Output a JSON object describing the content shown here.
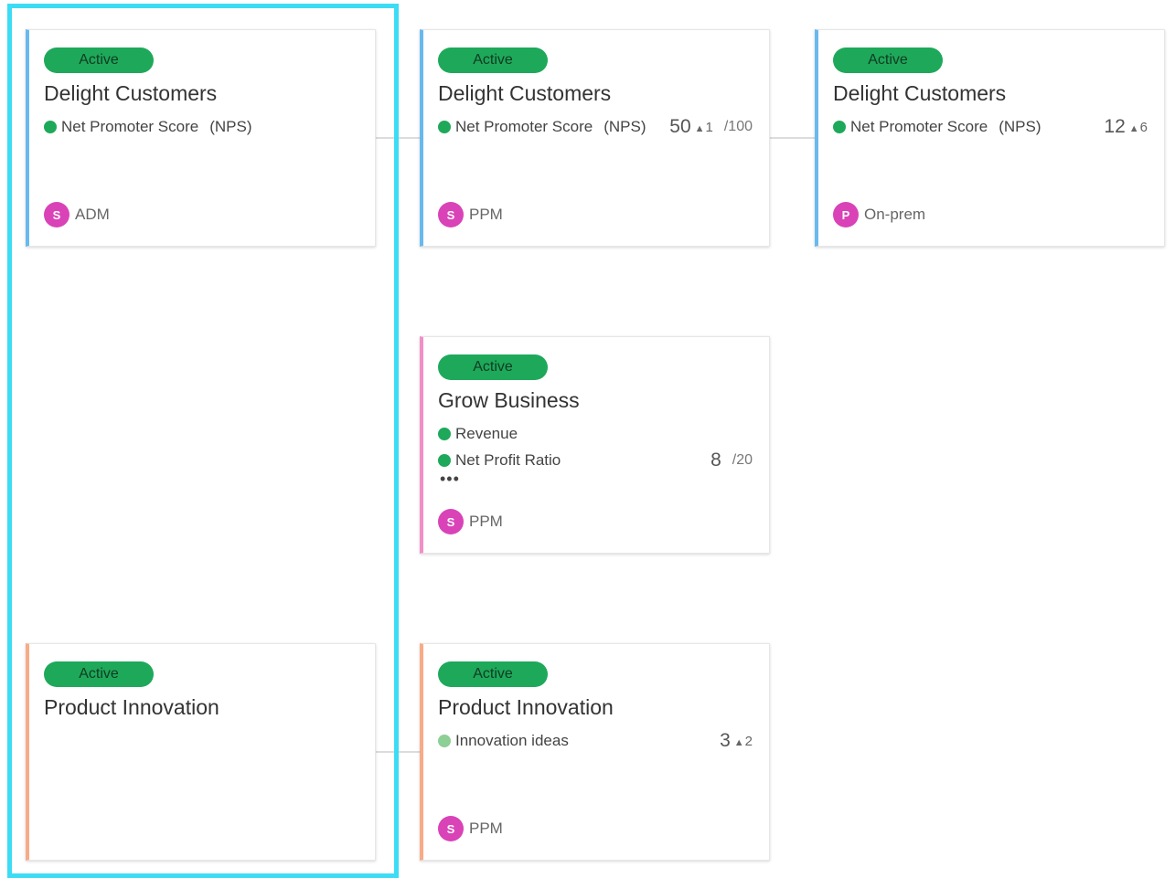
{
  "cards": [
    {
      "status": "Active",
      "title": "Delight Customers",
      "metrics": [
        {
          "name": "Net Promoter Score",
          "tag": "(NPS)",
          "value": "",
          "delta": "",
          "target": ""
        }
      ],
      "owner": {
        "initial": "S",
        "name": "ADM"
      }
    },
    {
      "status": "Active",
      "title": "Delight Customers",
      "metrics": [
        {
          "name": "Net Promoter Score",
          "tag": "(NPS)",
          "value": "50",
          "delta": "1",
          "target": "/100"
        }
      ],
      "owner": {
        "initial": "S",
        "name": "PPM"
      }
    },
    {
      "status": "Active",
      "title": "Delight Customers",
      "metrics": [
        {
          "name": "Net Promoter Score",
          "tag": "(NPS)",
          "value": "12",
          "delta": "6",
          "target": ""
        }
      ],
      "owner": {
        "initial": "P",
        "name": "On-prem"
      }
    },
    {
      "status": "Active",
      "title": "Grow Business",
      "metrics": [
        {
          "name": "Revenue",
          "tag": "",
          "value": "",
          "delta": "",
          "target": ""
        },
        {
          "name": "Net Profit Ratio",
          "tag": "",
          "value": "8",
          "delta": "",
          "target": "/20"
        }
      ],
      "more": "•••",
      "owner": {
        "initial": "S",
        "name": "PPM"
      }
    },
    {
      "status": "Active",
      "title": "Product Innovation",
      "metrics": [],
      "owner": null
    },
    {
      "status": "Active",
      "title": "Product Innovation",
      "metrics": [
        {
          "name": "Innovation ideas",
          "tag": "",
          "value": "3",
          "delta": "2",
          "target": ""
        }
      ],
      "owner": {
        "initial": "S",
        "name": "PPM"
      }
    }
  ],
  "colors": {
    "status_active": "#1ea95a",
    "accent_blue": "#6ab9ee",
    "accent_pink": "#f28fc6",
    "accent_orange": "#f7ab88",
    "avatar": "#d943b7",
    "selection_highlight": "#3ddcf5"
  },
  "icons": {
    "status_dot": "status-dot-icon",
    "delta_up": "triangle-up-icon"
  }
}
